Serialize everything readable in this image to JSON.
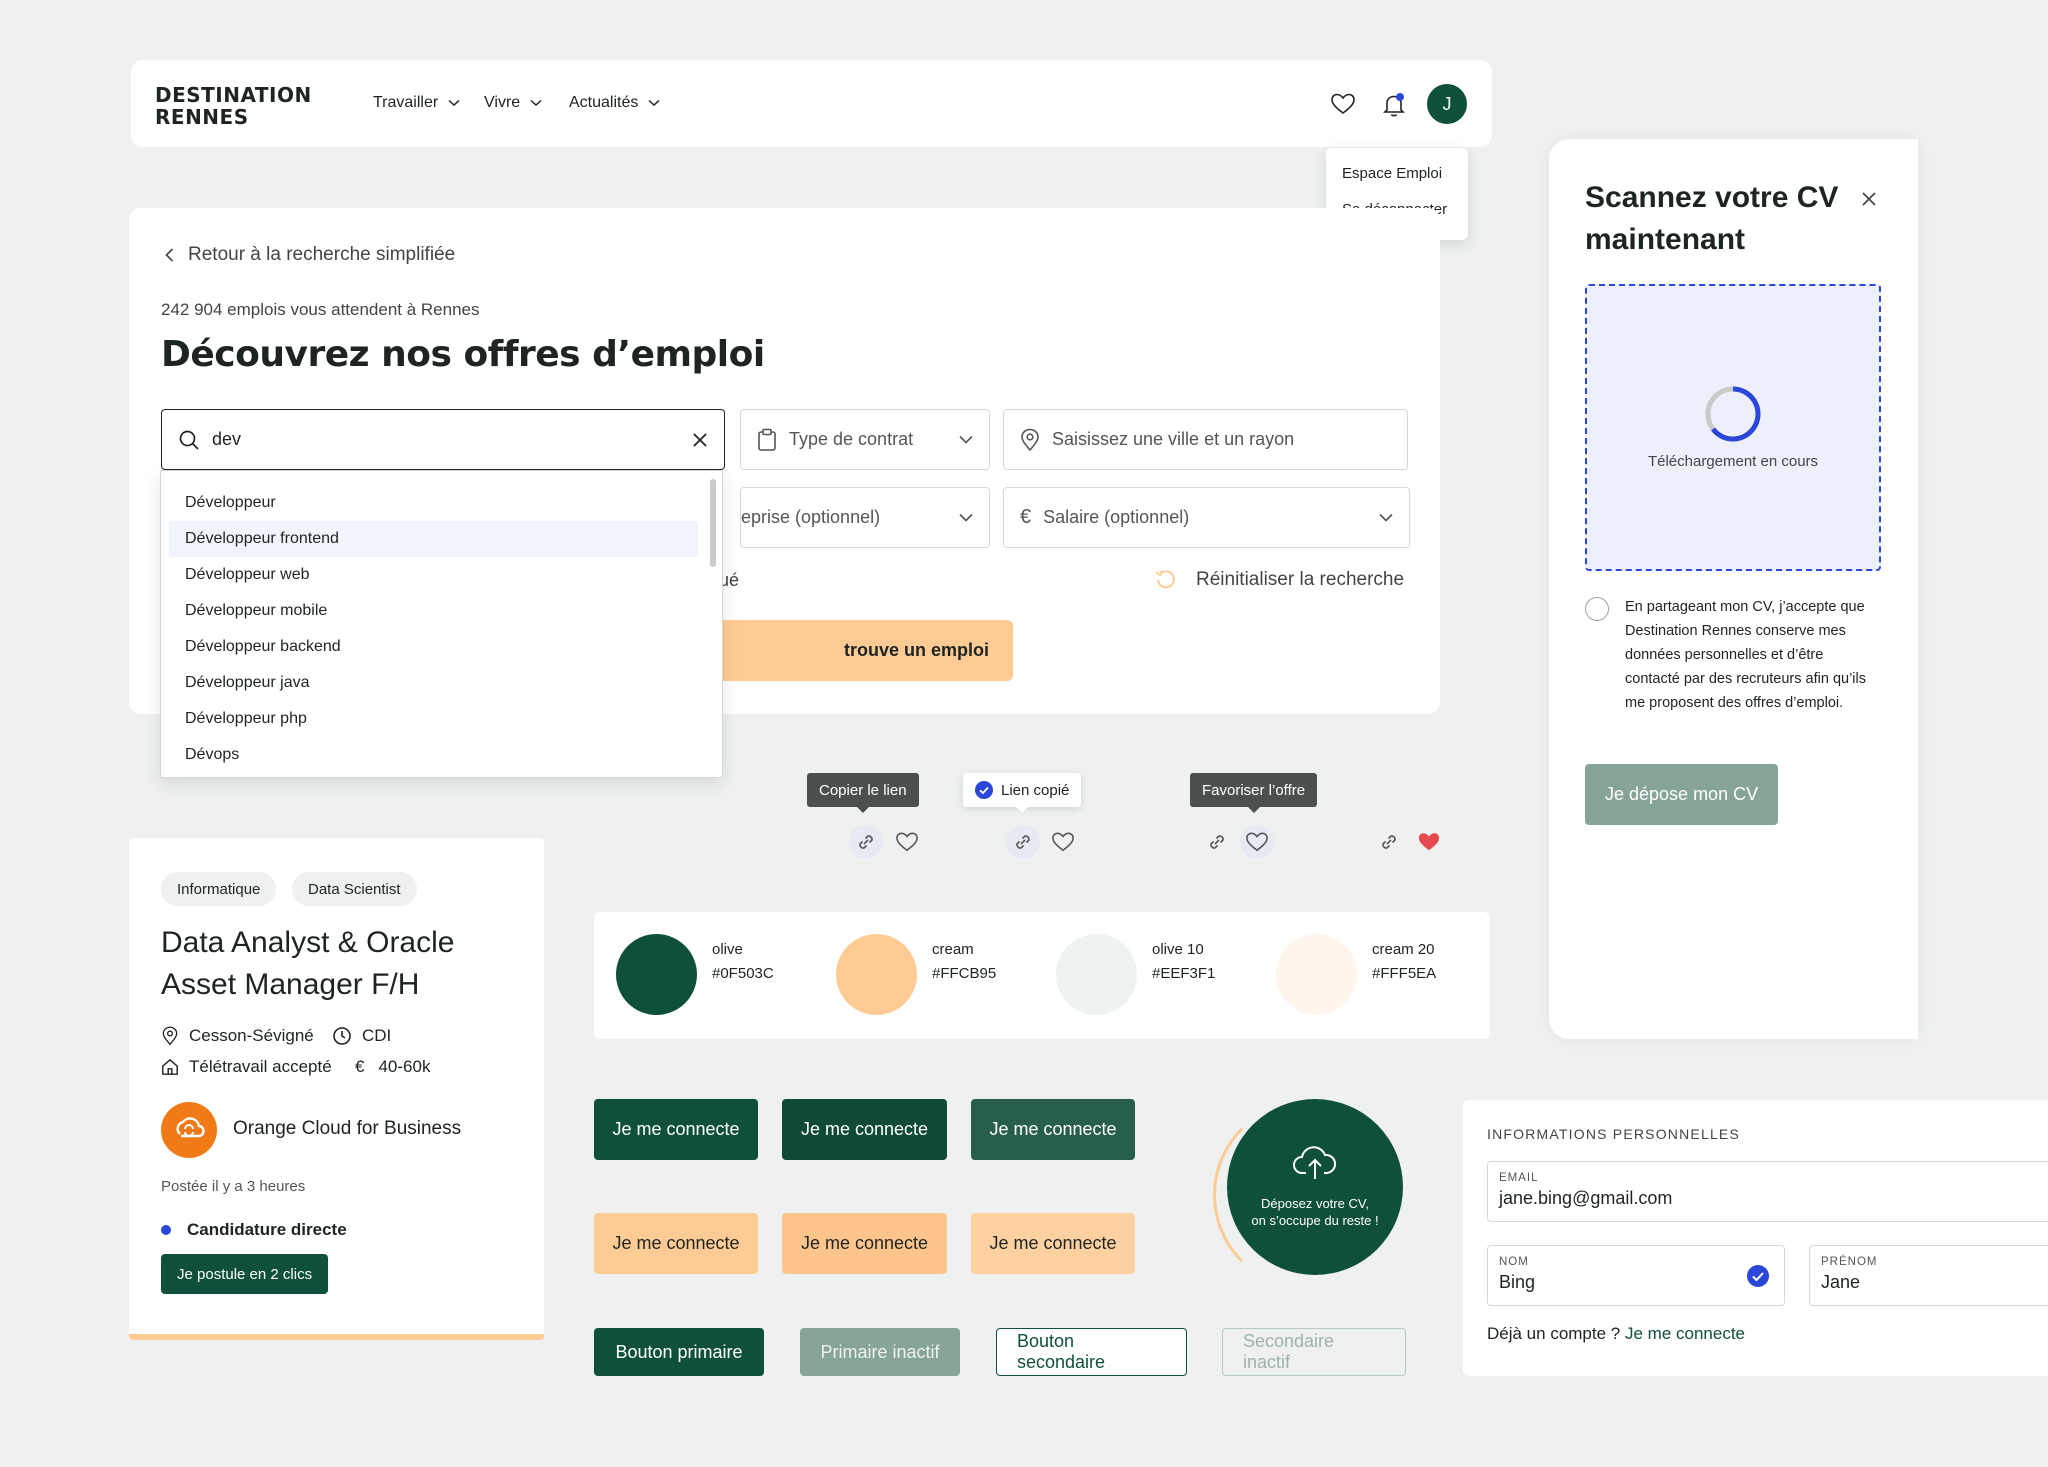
{
  "header": {
    "logo_line1": "DESTINATION",
    "logo_line2": "RENNES",
    "nav": [
      "Travailler",
      "Vivre",
      "Actualités"
    ],
    "avatar_initial": "J",
    "account_menu": [
      "Espace Emploi",
      "Se déconnecter"
    ]
  },
  "search": {
    "back_label": "Retour à la recherche simplifiée",
    "job_count": "242 904 emplois vous attendent à Rennes",
    "title": "Découvrez nos offres d’emploi",
    "query": "dev",
    "contract_placeholder": "Type de contrat",
    "city_placeholder": "Saisissez une ville et un rayon",
    "company_placeholder_partial": "eprise (optionnel)",
    "salary_placeholder": "Salaire (optionnel)",
    "partial_label": "qué",
    "reset_label": "Réinitialiser la recherche",
    "submit_partial": "trouve un emploi",
    "suggestions": [
      "Développeur",
      "Développeur frontend",
      "Développeur web",
      "Développeur mobile",
      "Développeur backend",
      "Développeur java",
      "Développeur php",
      "Dévops"
    ],
    "active_suggestion": 1
  },
  "tooltips": {
    "copy_link": "Copier le lien",
    "link_copied": "Lien copié",
    "favorite": "Favoriser l’offre"
  },
  "job_card": {
    "tags": [
      "Informatique",
      "Data Scientist"
    ],
    "title": "Data Analyst & Oracle Asset Manager F/H",
    "location": "Cesson-Sévigné",
    "contract": "CDI",
    "remote": "Télétravail accepté",
    "salary": "40-60k",
    "company": "Orange Cloud for Business",
    "company_logo_text": "Orange Cloud",
    "posted": "Postée il y a 3 heures",
    "application_type": "Candidature directe",
    "apply_label": "Je postule en 2 clics"
  },
  "palette": [
    {
      "name": "olive",
      "hex": "#0F503C"
    },
    {
      "name": "cream",
      "hex": "#FFCB95"
    },
    {
      "name": "olive 10",
      "hex": "#EEF3F1"
    },
    {
      "name": "cream 20",
      "hex": "#FFF5EA"
    }
  ],
  "buttons": {
    "connect": "Je me connecte",
    "primary": "Bouton primaire",
    "primary_disabled": "Primaire inactif",
    "secondary": "Bouton secondaire",
    "secondary_disabled": "Secondaire inactif"
  },
  "upload": {
    "text_line1": "Déposez votre CV,",
    "text_line2": "on s’occupe du reste !"
  },
  "scan_cv": {
    "title": "Scannez votre CV maintenant",
    "status": "Téléchargement en cours",
    "consent": "En partageant mon CV, j’accepte que Destination Rennes conserve mes données personnelles et d’être contacté par des recruteurs afin qu’ils me proposent des offres d’emploi.",
    "submit": "Je dépose mon CV"
  },
  "personal_info": {
    "heading": "INFORMATIONS PERSONNELLES",
    "email_label": "EMAIL",
    "email_value": "jane.bing@gmail.com",
    "lastname_label": "NOM",
    "lastname_value": "Bing",
    "firstname_label": "PRÉNOM",
    "firstname_value": "Jane",
    "already_prefix": "Déjà un compte ?",
    "already_link": "Je me connecte"
  },
  "colors": {
    "olive": "#0F503C",
    "cream": "#FFCB95",
    "olive10": "#EEF3F1",
    "cream20": "#FFF5EA",
    "accent_blue": "#2B47D9",
    "heart_red": "#E5484D"
  }
}
